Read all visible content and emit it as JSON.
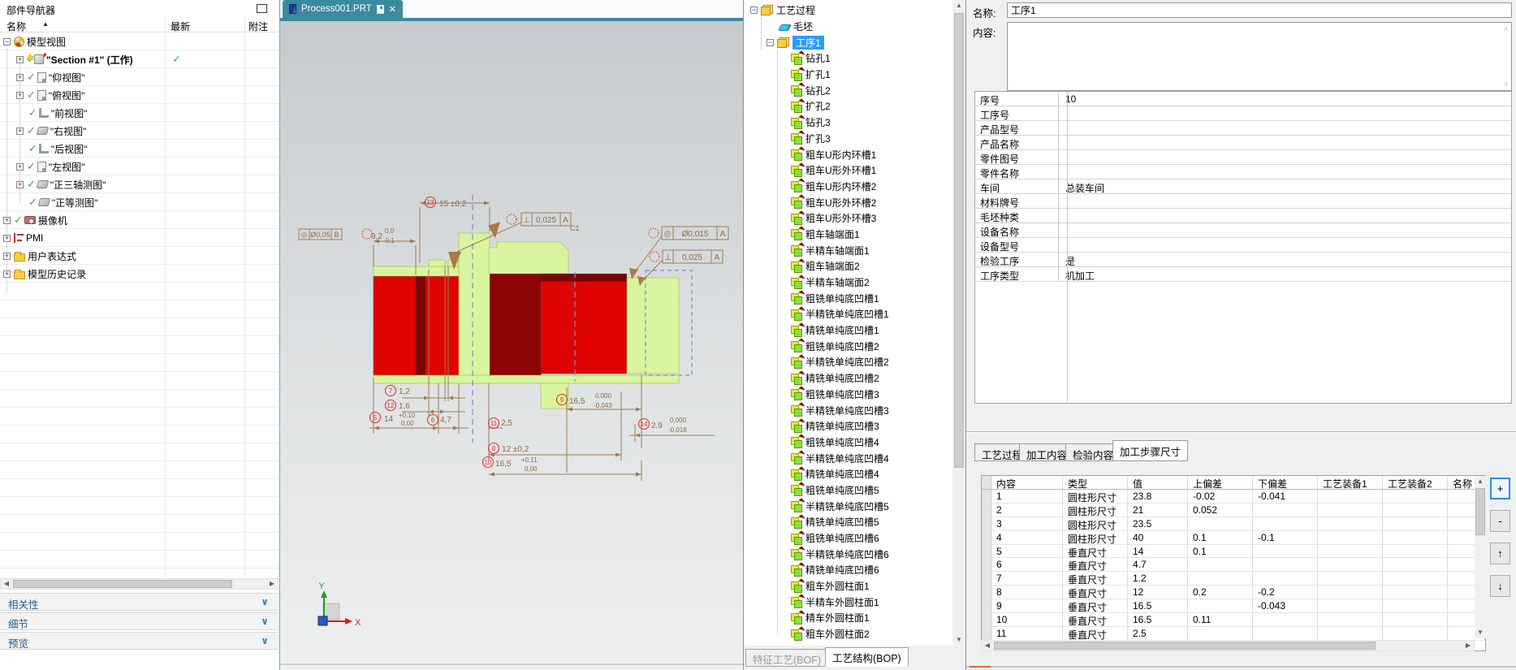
{
  "part_navigator": {
    "title": "部件导航器",
    "columns": {
      "name": "名称",
      "latest": "最新",
      "note": "附注"
    },
    "items": [
      {
        "label": "模型视图",
        "icon": "wheel",
        "expander": "minus",
        "level": 0,
        "check": "none",
        "latest": ""
      },
      {
        "label": "\"Section #1\" (工作)",
        "icon": "cube",
        "expander": "plus",
        "level": 1,
        "check": "warn",
        "bold": true,
        "latest": "check"
      },
      {
        "label": "\"仰视图\"",
        "icon": "page",
        "expander": "plus",
        "level": 1,
        "check": "yes"
      },
      {
        "label": "\"俯视图\"",
        "icon": "page",
        "expander": "plus",
        "level": 1,
        "check": "yes"
      },
      {
        "label": "\"前视图\"",
        "icon": "corner",
        "expander": "none",
        "level": 1,
        "check": "yes"
      },
      {
        "label": "\"右视图\"",
        "icon": "iso",
        "expander": "plus",
        "level": 1,
        "check": "yes"
      },
      {
        "label": "\"后视图\"",
        "icon": "corner",
        "expander": "none",
        "level": 1,
        "check": "yes"
      },
      {
        "label": "\"左视图\"",
        "icon": "page",
        "expander": "plus",
        "level": 1,
        "check": "yes"
      },
      {
        "label": "\"正三轴测图\"",
        "icon": "iso",
        "expander": "plus",
        "level": 1,
        "check": "yes"
      },
      {
        "label": "\"正等测图\"",
        "icon": "iso",
        "expander": "none",
        "level": 1,
        "check": "yes"
      },
      {
        "label": "摄像机",
        "icon": "cam",
        "expander": "plus",
        "level": 0,
        "check": "yes"
      },
      {
        "label": "PMI",
        "icon": "pmi",
        "expander": "plus",
        "level": 0,
        "check": "none"
      },
      {
        "label": "用户表达式",
        "icon": "folder",
        "expander": "plus",
        "level": 0,
        "check": "none"
      },
      {
        "label": "模型历史记录",
        "icon": "folder",
        "expander": "plus",
        "level": 0,
        "check": "none"
      }
    ],
    "sections": [
      "相关性",
      "细节",
      "预览"
    ]
  },
  "viewport": {
    "tab": {
      "title": "Process001.PRT"
    },
    "triad": {
      "x": "X",
      "y": "Y"
    },
    "annotations": {
      "dim13": {
        "balloon": "13",
        "text": "15 ±0,2"
      },
      "fcf_flat": {
        "sym": "◎",
        "val": "Ø0,05",
        "datum": "B"
      },
      "dim92": {
        "text": "9,2",
        "up": "0,0",
        "dn": "-0,1"
      },
      "fcf_perp1": {
        "sym": "⊥",
        "val": "0,025",
        "datum": "A"
      },
      "chamfer": {
        "text": "C1"
      },
      "fcf_conc": {
        "sym": "◎",
        "val": "Ø0,015",
        "datum": "A"
      },
      "fcf_perp2": {
        "sym": "⊥",
        "val": "0,025",
        "datum": "A"
      },
      "dim7": {
        "balloon": "7",
        "text": "1,2"
      },
      "dim12": {
        "balloon": "12",
        "text": "1,6"
      },
      "dim5": {
        "balloon": "5",
        "text": "14",
        "up": "+0,10",
        "dn": "0,00"
      },
      "dim6": {
        "balloon": "6",
        "text": "4,7"
      },
      "dim11": {
        "balloon": "11",
        "text": "2,5"
      },
      "dim8": {
        "balloon": "8",
        "text": "12 ±0,2"
      },
      "dim10": {
        "balloon": "10",
        "text": "16,5",
        "up": "+0,11",
        "dn": "0,00"
      },
      "dim9": {
        "balloon": "9",
        "text": "16,5",
        "up": "0,000",
        "dn": "-0,043"
      },
      "dim14": {
        "balloon": "14",
        "text": "2,9",
        "up": "0,000",
        "dn": "-0,018"
      }
    },
    "colors": {
      "part_green": "#d8f59e",
      "part_red": "#de0400",
      "part_dark_red": "#8c0404",
      "annotation": "#9b7c55"
    }
  },
  "process_tree": {
    "root": "工艺过程",
    "blank": "毛坯",
    "operation": "工序1",
    "steps": [
      "钻孔1",
      "扩孔1",
      "钻孔2",
      "扩孔2",
      "钻孔3",
      "扩孔3",
      "粗车U形内环槽1",
      "粗车U形外环槽1",
      "粗车U形内环槽2",
      "粗车U形外环槽2",
      "粗车U形外环槽3",
      "粗车轴端面1",
      "半精车轴端面1",
      "粗车轴端面2",
      "半精车轴端面2",
      "粗铣单纯底凹槽1",
      "半精铣单纯底凹槽1",
      "精铣单纯底凹槽1",
      "粗铣单纯底凹槽2",
      "半精铣单纯底凹槽2",
      "精铣单纯底凹槽2",
      "粗铣单纯底凹槽3",
      "半精铣单纯底凹槽3",
      "精铣单纯底凹槽3",
      "粗铣单纯底凹槽4",
      "半精铣单纯底凹槽4",
      "精铣单纯底凹槽4",
      "粗铣单纯底凹槽5",
      "半精铣单纯底凹槽5",
      "精铣单纯底凹槽5",
      "粗铣单纯底凹槽6",
      "半精铣单纯底凹槽6",
      "精铣单纯底凹槽6",
      "粗车外圆柱面1",
      "半精车外圆柱面1",
      "精车外圆柱面1",
      "粗车外圆柱面2"
    ],
    "tabs": [
      {
        "label": "特征工艺(BOF)",
        "active": false
      },
      {
        "label": "工艺结构(BOP)",
        "active": true
      }
    ]
  },
  "detail_panel": {
    "name_label": "名称:",
    "name_value": "工序1",
    "content_label": "内容:",
    "content_value": "",
    "properties": [
      {
        "label": "序号",
        "value": "10"
      },
      {
        "label": "工序号",
        "value": ""
      },
      {
        "label": "产品型号",
        "value": ""
      },
      {
        "label": "产品名称",
        "value": ""
      },
      {
        "label": "零件图号",
        "value": ""
      },
      {
        "label": "零件名称",
        "value": ""
      },
      {
        "label": "车间",
        "value": "总装车间"
      },
      {
        "label": "材料牌号",
        "value": ""
      },
      {
        "label": "毛坯种类",
        "value": ""
      },
      {
        "label": "设备名称",
        "value": ""
      },
      {
        "label": "设备型号",
        "value": ""
      },
      {
        "label": "检验工序",
        "value": "是"
      },
      {
        "label": "工序类型",
        "value": "机加工"
      }
    ]
  },
  "steps_panel": {
    "tabs": [
      {
        "label": "工艺过程",
        "active": false
      },
      {
        "label": "加工内容",
        "active": false
      },
      {
        "label": "检验内容",
        "active": false
      },
      {
        "label": "加工步骤尺寸",
        "active": true
      }
    ],
    "table": {
      "headers": [
        "内容",
        "类型",
        "值",
        "上偏差",
        "下偏差",
        "工艺装备1",
        "工艺装备2",
        "名称"
      ],
      "rows": [
        [
          "1",
          "圆柱形尺寸",
          "23.8",
          "-0.02",
          "-0.041",
          "",
          "",
          ""
        ],
        [
          "2",
          "圆柱形尺寸",
          "21",
          "0.052",
          "",
          "",
          "",
          ""
        ],
        [
          "3",
          "圆柱形尺寸",
          "23.5",
          "",
          "",
          "",
          "",
          ""
        ],
        [
          "4",
          "圆柱形尺寸",
          "40",
          "0.1",
          "-0.1",
          "",
          "",
          ""
        ],
        [
          "5",
          "垂直尺寸",
          "14",
          "0.1",
          "",
          "",
          "",
          ""
        ],
        [
          "6",
          "垂直尺寸",
          "4.7",
          "",
          "",
          "",
          "",
          ""
        ],
        [
          "7",
          "垂直尺寸",
          "1.2",
          "",
          "",
          "",
          "",
          ""
        ],
        [
          "8",
          "垂直尺寸",
          "12",
          "0.2",
          "-0.2",
          "",
          "",
          ""
        ],
        [
          "9",
          "垂直尺寸",
          "16.5",
          "",
          "-0.043",
          "",
          "",
          ""
        ],
        [
          "10",
          "垂直尺寸",
          "16.5",
          "0.11",
          "",
          "",
          "",
          ""
        ],
        [
          "11",
          "垂直尺寸",
          "2.5",
          "",
          "",
          "",
          "",
          ""
        ]
      ]
    },
    "buttons": [
      {
        "name": "add",
        "label": "+"
      },
      {
        "name": "remove",
        "label": "-"
      },
      {
        "name": "move-up",
        "label": "↑"
      },
      {
        "name": "move-down",
        "label": "↓"
      }
    ]
  }
}
